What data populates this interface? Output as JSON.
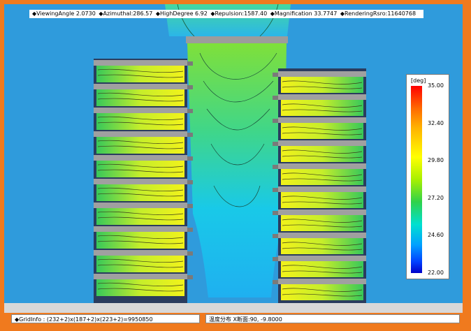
{
  "status_bar": {
    "viewing_angle": "◆ViewingAngle 2.0730",
    "azimuthal": "◆Azimuthal:286.57",
    "high_degree": "◆HighDegree 6.92",
    "repulsion": "◆Repulsion:1587.40",
    "magnification": "◆Magnification 33.7747",
    "rendering": "◆RenderingRsro:11640768"
  },
  "legend": {
    "unit": "[deg]",
    "ticks": [
      "35.00",
      "32.40",
      "29.80",
      "27.20",
      "24.60",
      "22.00"
    ],
    "range": [
      22.0,
      35.0
    ]
  },
  "footer": {
    "grid_info": "◆GridInfo : (232+2)x(187+2)x(223+2)=9950850",
    "section_info": "温度分布 X断面:90, -9.8000"
  },
  "colors": {
    "frame": "#f07a1e",
    "background": "#2f9bdc",
    "shelf": "#a0a0a0"
  }
}
